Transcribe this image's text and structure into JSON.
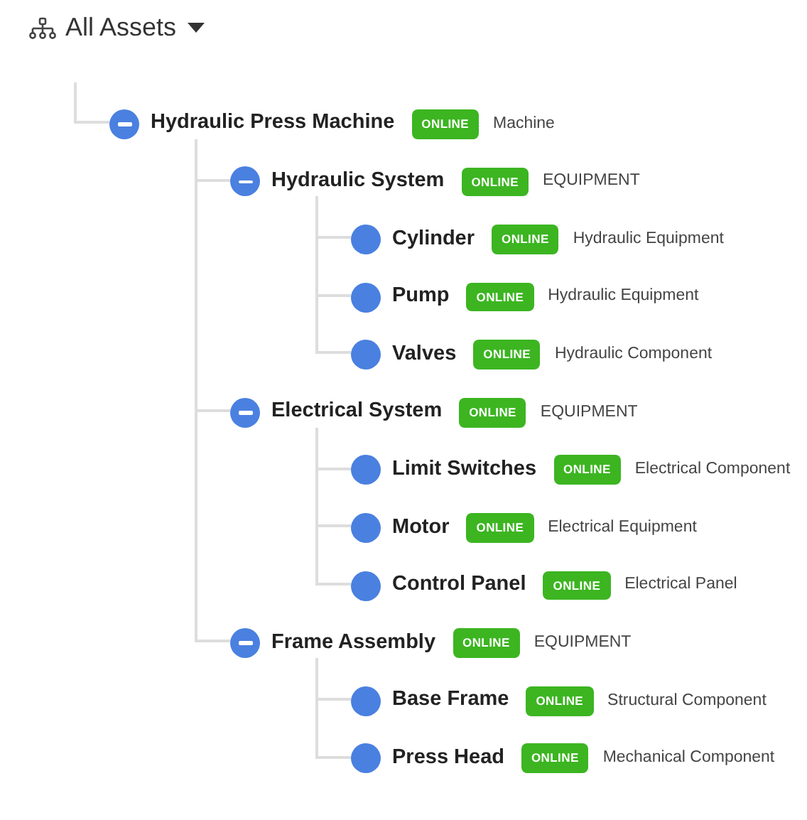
{
  "header": {
    "title": "All Assets"
  },
  "tree": [
    {
      "name": "Hydraulic Press Machine",
      "status": "ONLINE",
      "type": "Machine",
      "expanded": true,
      "children": [
        {
          "name": "Hydraulic System",
          "status": "ONLINE",
          "type": "EQUIPMENT",
          "expanded": true,
          "children": [
            {
              "name": "Cylinder",
              "status": "ONLINE",
              "type": "Hydraulic Equipment"
            },
            {
              "name": "Pump",
              "status": "ONLINE",
              "type": "Hydraulic Equipment"
            },
            {
              "name": "Valves",
              "status": "ONLINE",
              "type": "Hydraulic Component"
            }
          ]
        },
        {
          "name": "Electrical System",
          "status": "ONLINE",
          "type": "EQUIPMENT",
          "expanded": true,
          "children": [
            {
              "name": "Limit Switches",
              "status": "ONLINE",
              "type": "Electrical Component"
            },
            {
              "name": "Motor",
              "status": "ONLINE",
              "type": "Electrical Equipment"
            },
            {
              "name": "Control Panel",
              "status": "ONLINE",
              "type": "Electrical Panel"
            }
          ]
        },
        {
          "name": "Frame Assembly",
          "status": "ONLINE",
          "type": "EQUIPMENT",
          "expanded": true,
          "children": [
            {
              "name": "Base Frame",
              "status": "ONLINE",
              "type": "Structural Component"
            },
            {
              "name": "Press Head",
              "status": "ONLINE",
              "type": "Mechanical Component"
            }
          ]
        }
      ]
    }
  ]
}
